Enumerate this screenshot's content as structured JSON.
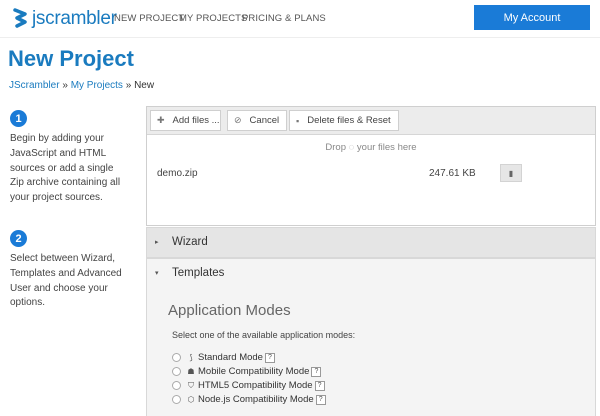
{
  "brand": {
    "name": "jscrambler",
    "color": "#1a7bbf"
  },
  "nav": {
    "links": [
      "NEW PROJECT",
      "MY PROJECTS",
      "PRICING & PLANS"
    ],
    "account_label": "My Account",
    "account_color": "#1a7bd7"
  },
  "page": {
    "title": "New Project",
    "breadcrumb": {
      "crumb1": "JScrambler",
      "sep": "»",
      "crumb2": "My Projects",
      "current": "New"
    }
  },
  "steps": [
    {
      "number": "1",
      "text": "Begin by adding your JavaScript and HTML sources or add a single Zip archive containing all your project sources."
    },
    {
      "number": "2",
      "text": "Select between Wizard, Templates and Advanced User and choose your options."
    }
  ],
  "upload": {
    "add_label": "Add files ...",
    "add_icon": "plus-icon",
    "cancel_label": "Cancel",
    "cancel_icon": "cancel-icon",
    "reset_label": "Delete files & Reset",
    "reset_icon": "trash-icon",
    "drop_hint_before": "Drop",
    "drop_hint_after": "your files here",
    "files": [
      {
        "name": "demo.zip",
        "size": "247.61 KB"
      }
    ]
  },
  "sections": {
    "wizard_label": "Wizard",
    "templates_label": "Templates"
  },
  "modes": {
    "title": "Application Modes",
    "description": "Select one of the available application modes:",
    "help_glyph": "?",
    "items": [
      {
        "label": "Standard Mode",
        "icon": "standard-icon"
      },
      {
        "label": "Mobile Compatibility Mode",
        "icon": "android-icon"
      },
      {
        "label": "HTML5 Compatibility Mode",
        "icon": "html5-icon"
      },
      {
        "label": "Node.js Compatibility Mode",
        "icon": "nodejs-icon"
      }
    ]
  }
}
